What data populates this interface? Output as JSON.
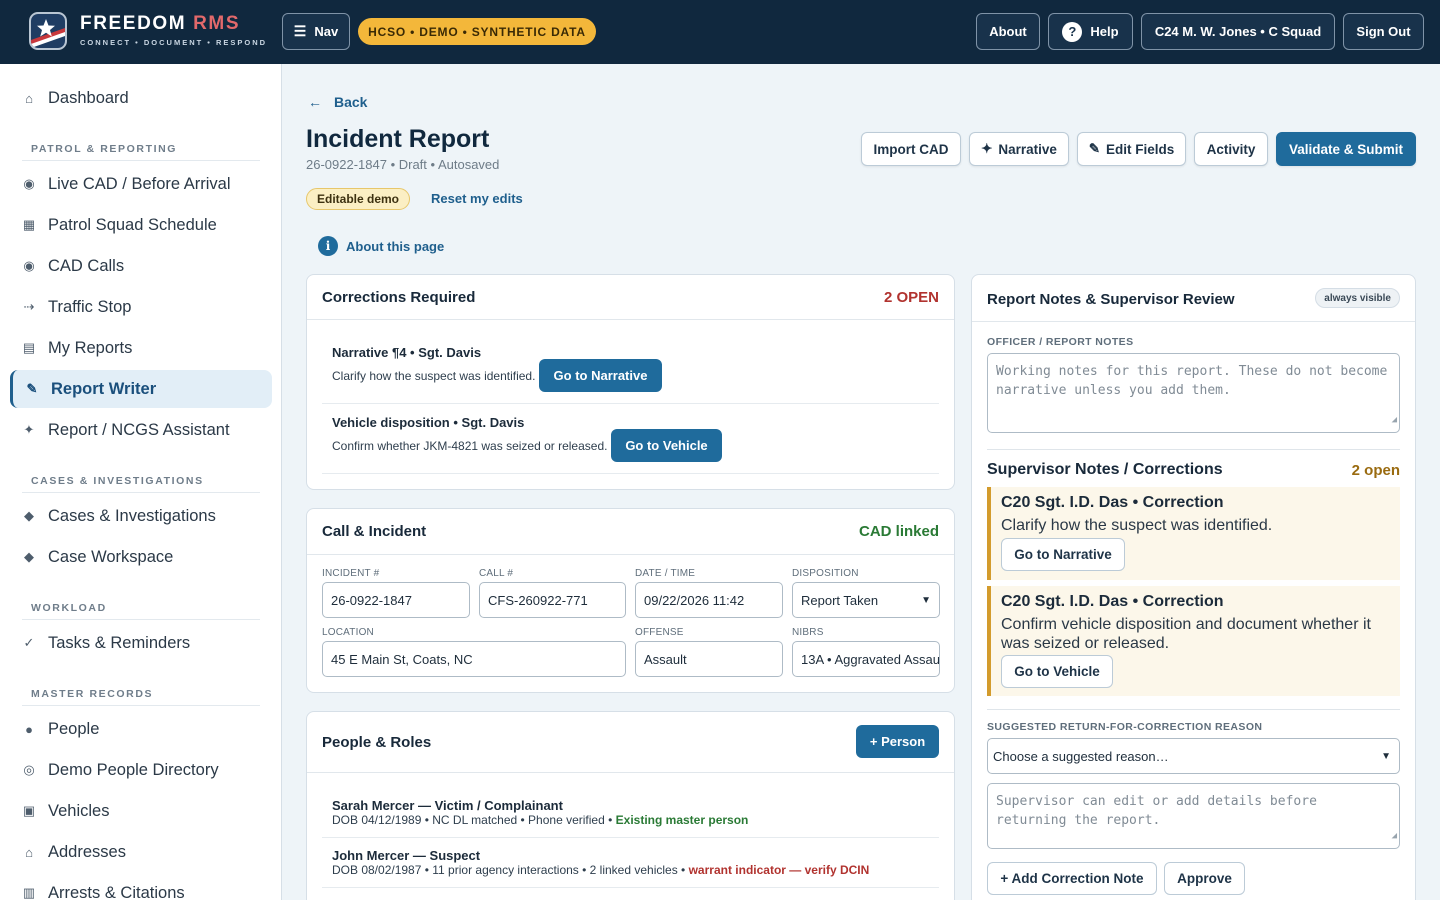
{
  "topbar": {
    "brand_main": "FREEDOM",
    "brand_accent": "RMS",
    "tagline": "CONNECT • DOCUMENT • RESPOND",
    "nav_label": "Nav",
    "demo_banner": "HCSO • DEMO • SYNTHETIC DATA",
    "about_label": "About",
    "help_label": "Help",
    "user_label": "C24 M. W. Jones • C Squad",
    "signout_label": "Sign Out"
  },
  "sidebar": {
    "dashboard": "Dashboard",
    "sections": {
      "patrol": "PATROL & REPORTING",
      "cases": "CASES & INVESTIGATIONS",
      "workload": "WORKLOAD",
      "master": "MASTER RECORDS"
    },
    "items": {
      "live_cad": "Live CAD / Before Arrival",
      "squad_schedule": "Patrol Squad Schedule",
      "cad_calls": "CAD Calls",
      "traffic_stop": "Traffic Stop",
      "my_reports": "My Reports",
      "report_writer": "Report Writer",
      "ncgs_assistant": "Report / NCGS Assistant",
      "cases_investigations": "Cases & Investigations",
      "case_workspace": "Case Workspace",
      "tasks": "Tasks & Reminders",
      "people": "People",
      "people_directory": "Demo People Directory",
      "vehicles": "Vehicles",
      "addresses": "Addresses",
      "arrests": "Arrests & Citations"
    }
  },
  "header": {
    "back_label": "Back",
    "title": "Incident Report",
    "subtitle": "26-0922-1847 • Draft • Autosaved",
    "editable_pill": "Editable demo",
    "reset_label": "Reset my edits",
    "about_page_label": "About this page",
    "buttons": {
      "import_cad": "Import CAD",
      "narrative": "Narrative",
      "edit_fields": "Edit Fields",
      "activity": "Activity",
      "validate_submit": "Validate & Submit"
    }
  },
  "corrections": {
    "title": "Corrections Required",
    "count": "2 OPEN",
    "items": [
      {
        "title": "Narrative ¶4 • Sgt. Davis",
        "desc": "Clarify how the suspect was identified.",
        "button": "Go to Narrative"
      },
      {
        "title": "Vehicle disposition • Sgt. Davis",
        "desc": "Confirm whether JKM-4821 was seized or released.",
        "button": "Go to Vehicle"
      }
    ]
  },
  "call_incident": {
    "title": "Call & Incident",
    "status": "CAD linked",
    "fields": {
      "incident_label": "INCIDENT #",
      "incident_value": "26-0922-1847",
      "call_label": "CALL #",
      "call_value": "CFS-260922-771",
      "datetime_label": "DATE / TIME",
      "datetime_value": "09/22/2026 11:42",
      "disposition_label": "DISPOSITION",
      "disposition_value": "Report Taken",
      "location_label": "LOCATION",
      "location_value": "45 E Main St, Coats, NC",
      "offense_label": "OFFENSE",
      "offense_value": "Assault",
      "nibrs_label": "NIBRS",
      "nibrs_value": "13A • Aggravated Assault"
    }
  },
  "people_roles": {
    "title": "People & Roles",
    "add_button": "+ Person",
    "people": [
      {
        "name": "Sarah Mercer — Victim / Complainant",
        "details": "DOB 04/12/1989 • NC DL matched • Phone verified •",
        "flag": "Existing master person"
      },
      {
        "name": "John Mercer — Suspect",
        "details": "DOB 08/02/1987 • 11 prior agency interactions • 2 linked vehicles •",
        "flag": "warrant indicator — verify DCIN"
      }
    ]
  },
  "notes_panel": {
    "title": "Report Notes & Supervisor Review",
    "always_visible": "always visible",
    "officer_notes_label": "OFFICER / REPORT NOTES",
    "officer_notes_placeholder": "Working notes for this report. These do not become narrative unless you add them.",
    "supervisor_title": "Supervisor Notes / Corrections",
    "supervisor_open": "2 open",
    "supervisor_items": [
      {
        "head": "C20 Sgt. I.D. Das • Correction",
        "text": "Clarify how the suspect was identified.",
        "button": "Go to Narrative"
      },
      {
        "head": "C20 Sgt. I.D. Das • Correction",
        "text": "Confirm vehicle disposition and document whether it was seized or released.",
        "button": "Go to Vehicle"
      }
    ],
    "reason_label": "SUGGESTED RETURN-FOR-CORRECTION REASON",
    "reason_select": "Choose a suggested reason…",
    "supervisor_placeholder": "Supervisor can edit or add details before returning the report.",
    "add_note_button": "+ Add Correction Note",
    "approve_button": "Approve"
  },
  "colors": {
    "topbar": "#10283e",
    "primary": "#1f6b9c",
    "demo_pill": "#f3b73a",
    "open_red": "#b1332f",
    "cad_green": "#2a7a35",
    "warning_amber": "#9a6b10"
  }
}
